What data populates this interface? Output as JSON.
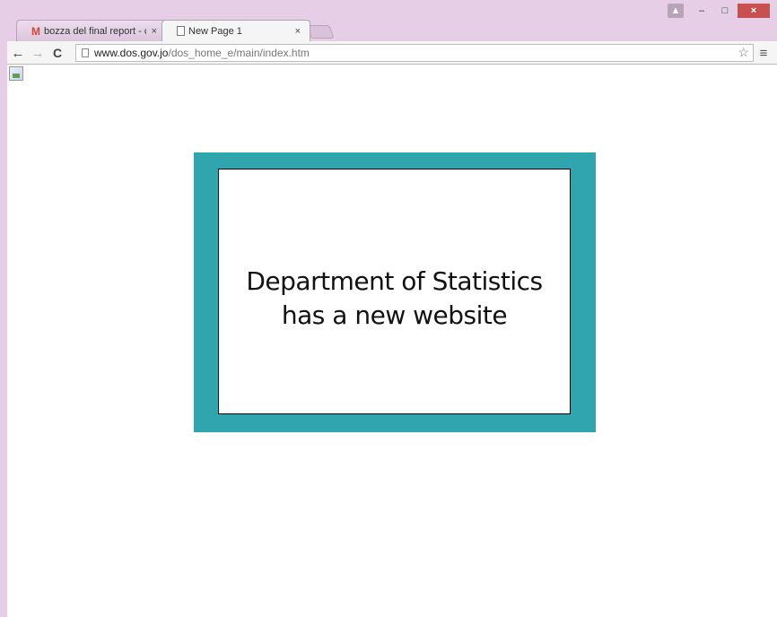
{
  "tabs": [
    {
      "icon": "gmail-icon",
      "title": "bozza del final report - ce",
      "close": "×"
    },
    {
      "icon": "page-icon",
      "title": "New Page 1",
      "close": "×"
    }
  ],
  "window_controls": {
    "profile": "▲",
    "minimize": "–",
    "maximize": "□",
    "close": "×"
  },
  "toolbar": {
    "back": "←",
    "forward": "→",
    "reload": "C",
    "url_host": "www.dos.gov.jo",
    "url_path": "/dos_home_e/main/index.htm",
    "star": "☆",
    "menu": "≡"
  },
  "banner": {
    "line1": "Department of Statistics",
    "line2": "has a new website"
  },
  "colors": {
    "banner_frame": "#31a5ae",
    "window_frame": "#e6cfe6"
  }
}
